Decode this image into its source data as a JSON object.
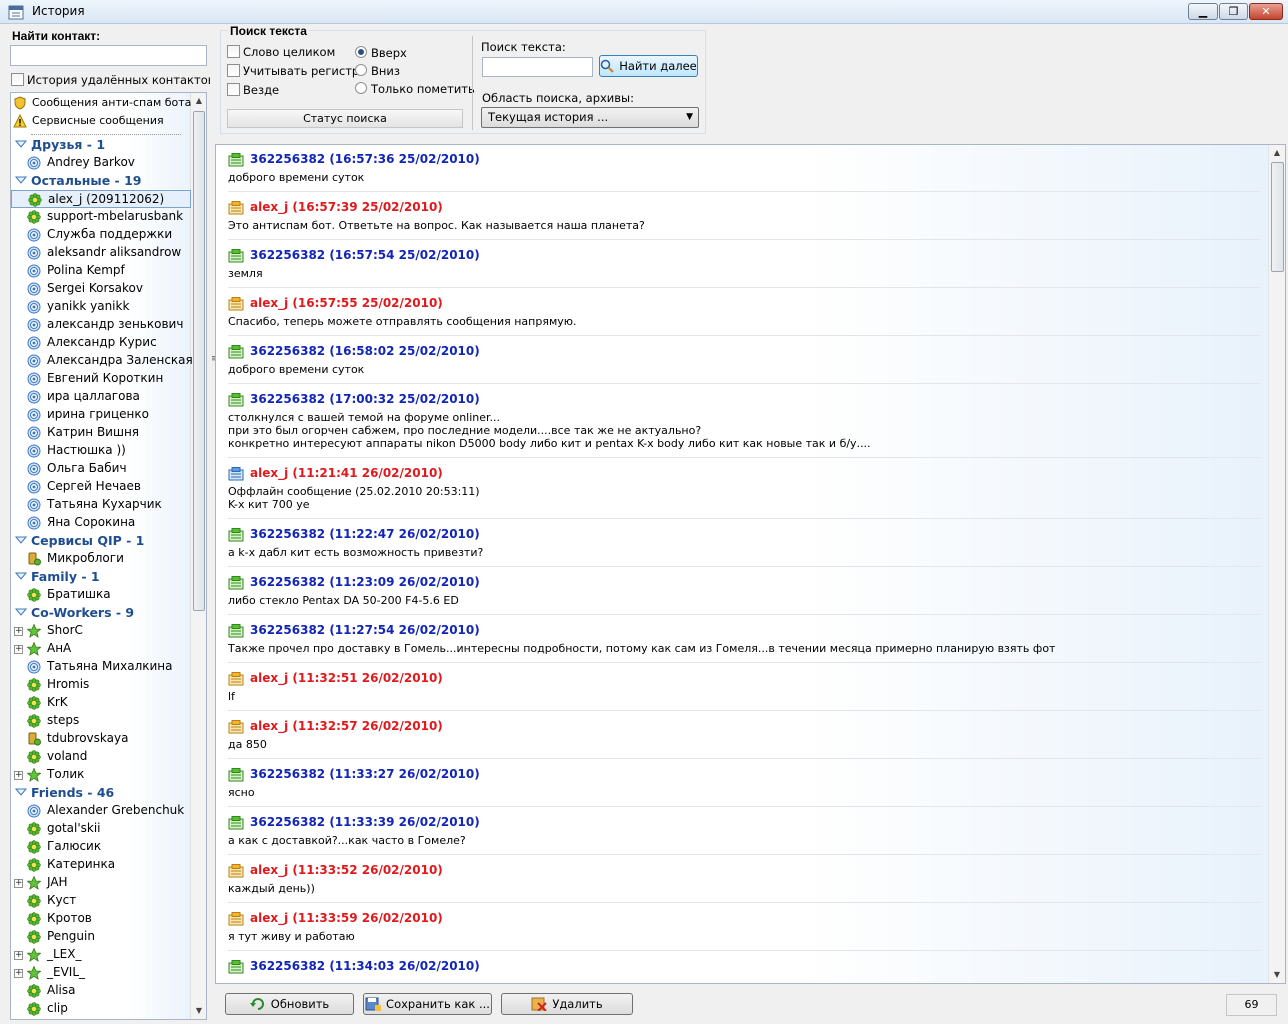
{
  "window": {
    "title": "История"
  },
  "contacts_panel": {
    "find_label": "Найти контакт:",
    "find_value": "",
    "deleted_history_label": "История удалённых контактов",
    "special_items": [
      {
        "label": "Сообщения анти-спам бота",
        "icon": "shield-icon"
      },
      {
        "label": "Сервисные сообщения",
        "icon": "warning-icon"
      }
    ],
    "groups": [
      {
        "name": "Друзья - 1",
        "contacts": [
          {
            "name": "Andrey Barkov",
            "icon": "icq-online-icon"
          }
        ]
      },
      {
        "name": "Остальные - 19",
        "contacts": [
          {
            "name": "alex_j (209112062)",
            "icon": "flower-icon",
            "selected": true
          },
          {
            "name": "support-mbelarusbank",
            "icon": "flower-icon"
          },
          {
            "name": "Служба поддержки",
            "icon": "icq-online-icon"
          },
          {
            "name": "aleksandr aliksandrow",
            "icon": "icq-online-icon"
          },
          {
            "name": "Polina Kempf",
            "icon": "icq-online-icon"
          },
          {
            "name": "Sergei Korsakov",
            "icon": "icq-online-icon"
          },
          {
            "name": "yanikk yanikk",
            "icon": "icq-online-icon"
          },
          {
            "name": "александр зенькович",
            "icon": "icq-online-icon"
          },
          {
            "name": "Александр Курис",
            "icon": "icq-online-icon"
          },
          {
            "name": "Александра Заленская",
            "icon": "icq-online-icon"
          },
          {
            "name": "Евгений Короткин",
            "icon": "icq-online-icon"
          },
          {
            "name": "ира цаллагова",
            "icon": "icq-online-icon"
          },
          {
            "name": "ирина гриценко",
            "icon": "icq-online-icon"
          },
          {
            "name": "Катрин Вишня",
            "icon": "icq-online-icon"
          },
          {
            "name": "Настюшка  ))",
            "icon": "icq-online-icon"
          },
          {
            "name": "Ольга Бабич",
            "icon": "icq-online-icon"
          },
          {
            "name": "Сергей Нечаев",
            "icon": "icq-online-icon"
          },
          {
            "name": "Татьяна Кухарчик",
            "icon": "icq-online-icon"
          },
          {
            "name": "Яна Сорокина",
            "icon": "icq-online-icon"
          }
        ]
      },
      {
        "name": "Сервисы QIP - 1",
        "contacts": [
          {
            "name": "Микроблоги",
            "icon": "microblog-icon"
          }
        ]
      },
      {
        "name": "Family - 1",
        "contacts": [
          {
            "name": "Братишка",
            "icon": "flower-icon"
          }
        ]
      },
      {
        "name": "Co-Workers - 9",
        "contacts": [
          {
            "name": "ShorC",
            "icon": "star-icon",
            "expandable": true
          },
          {
            "name": "AнA",
            "icon": "star-icon",
            "expandable": true
          },
          {
            "name": "Татьяна Михалкина",
            "icon": "icq-online-icon"
          },
          {
            "name": "Hromis",
            "icon": "flower-icon"
          },
          {
            "name": "KrK",
            "icon": "flower-icon"
          },
          {
            "name": "steps",
            "icon": "flower-icon"
          },
          {
            "name": "tdubrovskaya",
            "icon": "microblog-icon"
          },
          {
            "name": "voland",
            "icon": "flower-icon"
          },
          {
            "name": "Толик",
            "icon": "star-icon",
            "expandable": true
          }
        ]
      },
      {
        "name": "Friends - 46",
        "contacts": [
          {
            "name": "Alexander Grebenchuk",
            "icon": "icq-online-icon"
          },
          {
            "name": "gotal'skii",
            "icon": "flower-icon"
          },
          {
            "name": "Галюсик",
            "icon": "flower-icon"
          },
          {
            "name": "Катеринка",
            "icon": "flower-icon"
          },
          {
            "name": "JAH",
            "icon": "star-icon",
            "expandable": true
          },
          {
            "name": "Куст",
            "icon": "flower-icon"
          },
          {
            "name": "Кротов",
            "icon": "flower-icon"
          },
          {
            "name": "Penguin",
            "icon": "flower-icon"
          },
          {
            "name": "_LEX_",
            "icon": "star-icon",
            "expandable": true
          },
          {
            "name": "_EVIL_",
            "icon": "star-icon",
            "expandable": true
          },
          {
            "name": "Alisa",
            "icon": "flower-icon"
          },
          {
            "name": "clip",
            "icon": "flower-icon"
          }
        ]
      }
    ]
  },
  "search": {
    "legend": "Поиск текста",
    "whole_word": "Слово целиком",
    "match_case": "Учитывать регистр",
    "everywhere": "Везде",
    "dir_up": "Вверх",
    "dir_down": "Вниз",
    "only_mark": "Только пометить",
    "status": "Статус поиска",
    "text_label": "Поиск текста:",
    "text_value": "",
    "find_next": "Найти далее",
    "scope_label": "Область поиска, архивы:",
    "scope_value": "Текущая история ..."
  },
  "messages": [
    {
      "header": "362256382 (16:57:36 25/02/2010)",
      "from": "me",
      "icon": "message-in-icon",
      "body": "доброго времени суток"
    },
    {
      "header": "alex_j (16:57:39 25/02/2010)",
      "from": "them",
      "icon": "message-out-icon",
      "body": "Это антиспам бот. Ответьте на вопрос. Как называется наша планета?"
    },
    {
      "header": "362256382 (16:57:54 25/02/2010)",
      "from": "me",
      "icon": "message-in-icon",
      "body": "земля"
    },
    {
      "header": "alex_j (16:57:55 25/02/2010)",
      "from": "them",
      "icon": "message-out-icon",
      "body": "Спасибо, теперь можете отправлять сообщения напрямую."
    },
    {
      "header": "362256382 (16:58:02 25/02/2010)",
      "from": "me",
      "icon": "message-in-icon",
      "body": "доброго времени суток"
    },
    {
      "header": "362256382 (17:00:32 25/02/2010)",
      "from": "me",
      "icon": "message-in-icon",
      "body": "столкнулся с вашей темой на форуме onliner...\nпри это был огорчен сабжем, про последние модели....все так же не актуально?\nконкретно интересуют аппараты nikon D5000 body либо кит и pentax K-x body либо кит как новые так и б/у...."
    },
    {
      "header": "alex_j (11:21:41 26/02/2010)",
      "from": "them",
      "icon": "message-offline-icon",
      "body": "Оффлайн сообщение (25.02.2010 20:53:11)\nK-x кит 700 уе"
    },
    {
      "header": "362256382 (11:22:47 26/02/2010)",
      "from": "me",
      "icon": "message-in-icon",
      "body": "а k-x дабл кит есть возможность привезти?"
    },
    {
      "header": "362256382 (11:23:09 26/02/2010)",
      "from": "me",
      "icon": "message-in-icon",
      "body": "либо стекло Pentax DA 50-200 F4-5.6 ED"
    },
    {
      "header": "362256382 (11:27:54 26/02/2010)",
      "from": "me",
      "icon": "message-in-icon",
      "body": "Также прочел про доставку в Гомель...интересны подробности, потому как сам из Гомеля...в течении месяца примерно планирую взять фот"
    },
    {
      "header": "alex_j (11:32:51 26/02/2010)",
      "from": "them",
      "icon": "message-out-icon",
      "body": "lf"
    },
    {
      "header": "alex_j (11:32:57 26/02/2010)",
      "from": "them",
      "icon": "message-out-icon",
      "body": "да 850"
    },
    {
      "header": "362256382 (11:33:27 26/02/2010)",
      "from": "me",
      "icon": "message-in-icon",
      "body": "ясно"
    },
    {
      "header": "362256382 (11:33:39 26/02/2010)",
      "from": "me",
      "icon": "message-in-icon",
      "body": "а как с доставкой?...как часто в Гомеле?"
    },
    {
      "header": "alex_j (11:33:52 26/02/2010)",
      "from": "them",
      "icon": "message-out-icon",
      "body": "каждый день))"
    },
    {
      "header": "alex_j (11:33:59 26/02/2010)",
      "from": "them",
      "icon": "message-out-icon",
      "body": "я тут живу и работаю"
    },
    {
      "header": "362256382 (11:34:03 26/02/2010)",
      "from": "me",
      "icon": "message-in-icon",
      "body": ""
    }
  ],
  "footer": {
    "refresh": "Обновить",
    "save_as": "Сохранить как ...",
    "delete": "Удалить",
    "count": "69"
  },
  "colors": {
    "own_header": "#1226b6",
    "peer_header": "#e0191c",
    "group_header": "#1f4e90"
  }
}
